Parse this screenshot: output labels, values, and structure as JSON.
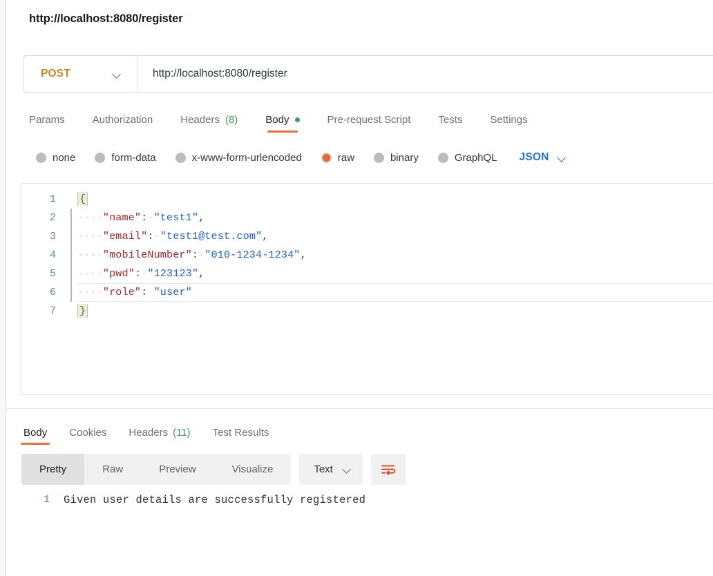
{
  "request": {
    "title": "http://localhost:8080/register",
    "method": "POST",
    "url": "http://localhost:8080/register",
    "tabs": [
      {
        "label": "Params",
        "count": "",
        "active": false,
        "dot": false
      },
      {
        "label": "Authorization",
        "count": "",
        "active": false,
        "dot": false
      },
      {
        "label": "Headers",
        "count": "(8)",
        "active": false,
        "dot": false
      },
      {
        "label": "Body",
        "count": "",
        "active": true,
        "dot": true
      },
      {
        "label": "Pre-request Script",
        "count": "",
        "active": false,
        "dot": false
      },
      {
        "label": "Tests",
        "count": "",
        "active": false,
        "dot": false
      },
      {
        "label": "Settings",
        "count": "",
        "active": false,
        "dot": false
      }
    ],
    "body_types": [
      {
        "label": "none",
        "selected": false
      },
      {
        "label": "form-data",
        "selected": false
      },
      {
        "label": "x-www-form-urlencoded",
        "selected": false
      },
      {
        "label": "raw",
        "selected": true
      },
      {
        "label": "binary",
        "selected": false
      },
      {
        "label": "GraphQL",
        "selected": false
      }
    ],
    "raw_format": "JSON",
    "editor": {
      "line_numbers": [
        "1",
        "2",
        "3",
        "4",
        "5",
        "6",
        "7"
      ],
      "lines": [
        {
          "n": "1",
          "open_brace": "{"
        },
        {
          "n": "2",
          "indent": "····",
          "key": "\"name\"",
          "colon": ":",
          "gap": "·",
          "value": "\"test1\"",
          "comma": ","
        },
        {
          "n": "3",
          "indent": "····",
          "key": "\"email\"",
          "colon": ":",
          "gap": "·",
          "value": "\"test1@test.com\"",
          "comma": ","
        },
        {
          "n": "4",
          "indent": "····",
          "key": "\"mobileNumber\"",
          "colon": ":",
          "gap": "·",
          "value": "\"010-1234-1234\"",
          "comma": ","
        },
        {
          "n": "5",
          "indent": "····",
          "key": "\"pwd\"",
          "colon": ":",
          "gap": "·",
          "value": "\"123123\"",
          "comma": ","
        },
        {
          "n": "6",
          "indent": "····",
          "key": "\"role\"",
          "colon": ":",
          "gap": "·",
          "value": "\"user\"",
          "comma": ""
        },
        {
          "n": "7",
          "close_brace": "}"
        }
      ]
    }
  },
  "response": {
    "tabs": [
      {
        "label": "Body",
        "count": "",
        "active": true
      },
      {
        "label": "Cookies",
        "count": "",
        "active": false
      },
      {
        "label": "Headers",
        "count": "(11)",
        "active": false
      },
      {
        "label": "Test Results",
        "count": "",
        "active": false
      }
    ],
    "view_modes": [
      {
        "label": "Pretty",
        "active": true
      },
      {
        "label": "Raw",
        "active": false
      },
      {
        "label": "Preview",
        "active": false
      },
      {
        "label": "Visualize",
        "active": false
      }
    ],
    "format": "Text",
    "body_line_number": "1",
    "body_text": "Given user details are successfully registered"
  },
  "colors": {
    "accent_orange": "#f26b3a",
    "method_amber": "#c18822",
    "link_blue": "#1f6fde",
    "status_green": "#3aa05a",
    "wrap_icon": "#d2401a"
  }
}
